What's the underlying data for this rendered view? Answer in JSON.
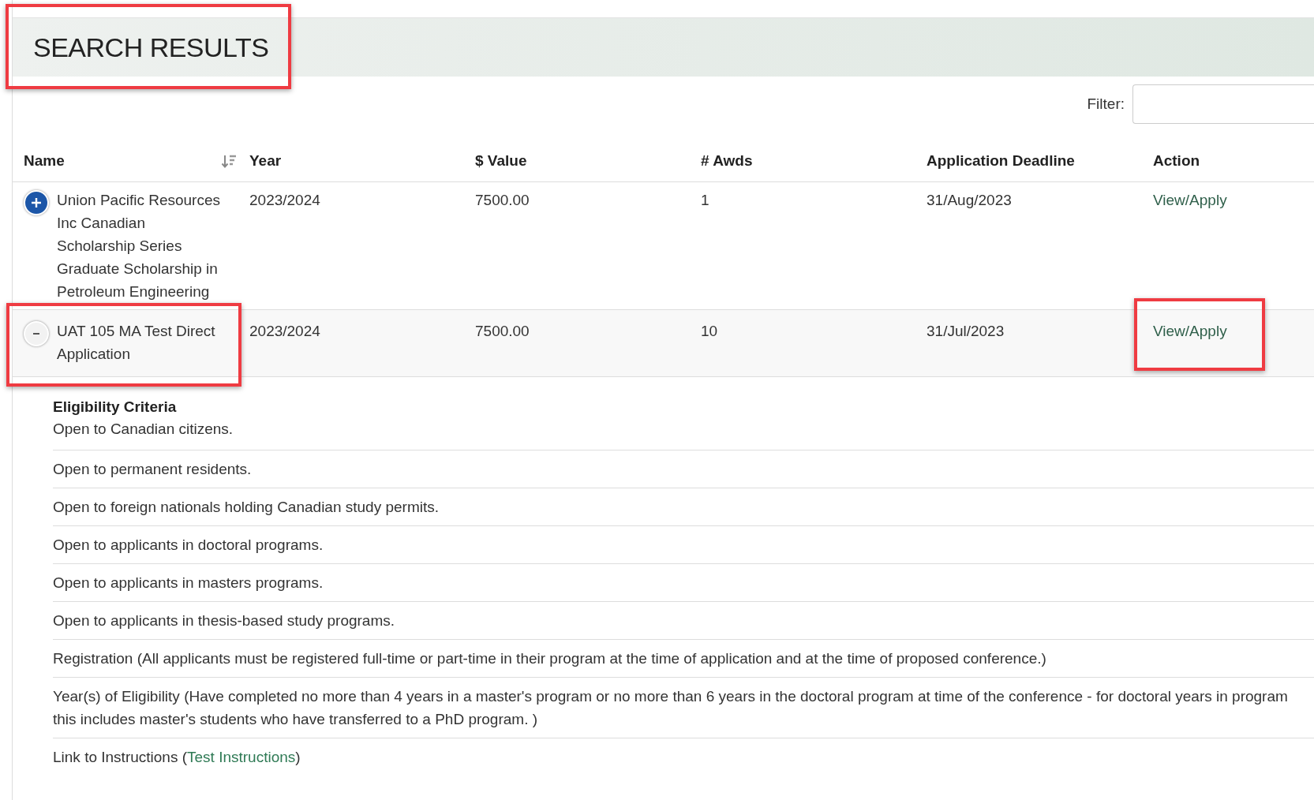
{
  "header": {
    "title": "SEARCH RESULTS",
    "highlighted": true
  },
  "filter": {
    "label": "Filter:"
  },
  "table": {
    "columns": [
      {
        "label": "Name",
        "sortable": true
      },
      {
        "label": "Year",
        "sortable": false
      },
      {
        "label": "$ Value",
        "sortable": false
      },
      {
        "label": "# Awds",
        "sortable": false
      },
      {
        "label": "Application Deadline",
        "sortable": false
      },
      {
        "label": "Action",
        "sortable": false
      }
    ],
    "rows": [
      {
        "name": "Union Pacific Resources Inc Canadian Scholarship Series Graduate Scholarship in Petroleum Engineering",
        "year": "2023/2024",
        "value": "7500.00",
        "awards": "1",
        "deadline": "31/Aug/2023",
        "action": "View/Apply",
        "expanded": false,
        "name_highlighted": false,
        "action_highlighted": false
      },
      {
        "name": "UAT 105 MA Test Direct Application",
        "year": "2023/2024",
        "value": "7500.00",
        "awards": "10",
        "deadline": "31/Jul/2023",
        "action": "View/Apply",
        "expanded": true,
        "name_highlighted": true,
        "action_highlighted": true
      }
    ]
  },
  "details": {
    "heading": "Eligibility Criteria",
    "items": [
      {
        "kind": "text",
        "text": "Open to Canadian citizens."
      },
      {
        "kind": "text",
        "text": "Open to permanent residents."
      },
      {
        "kind": "text",
        "text": "Open to foreign nationals holding Canadian study permits."
      },
      {
        "kind": "text",
        "text": "Open to applicants in doctoral programs."
      },
      {
        "kind": "text",
        "text": "Open to applicants in masters programs."
      },
      {
        "kind": "text",
        "text": "Open to applicants in thesis-based study programs."
      },
      {
        "kind": "text",
        "text": "Registration (All applicants must be registered full-time or part-time in their program at the time of application and at the time of proposed conference.)"
      },
      {
        "kind": "text",
        "text": "Year(s) of Eligibility (Have completed no more than 4 years in a master's program or no more than 6 years in the doctoral program at time of the conference - for doctoral years in program this includes master's students who have transferred to a PhD program. )"
      },
      {
        "kind": "link",
        "text": "Link to Instructions (",
        "link": "Test Instructions",
        "suffix": ")"
      }
    ]
  }
}
